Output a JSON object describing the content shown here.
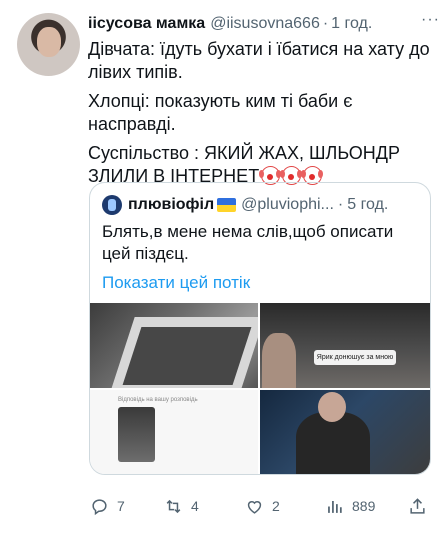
{
  "tweet": {
    "author_name": "іісусова мамка",
    "author_handle": "@iisusovna666",
    "separator": "·",
    "time": "1 год.",
    "more_label": "···",
    "lines": [
      "Дівчата: їдуть бухати і їбатися на хату до лівих типів.",
      "Хлопці: показують ким ті баби є насправді.",
      "Суспільство : ЯКИЙ ЖАХ, ШЛЬОНДР ЗЛИЛИ В ІНТЕРНЕТ"
    ],
    "emoji_count": 3,
    "emoji_name": "clown-face"
  },
  "quote": {
    "author_name": "плювіофіл",
    "author_handle": "@pluviophi...",
    "separator": "·",
    "time": "5 год.",
    "text": "Блять,в мене нема слів,щоб описати цей піздєц.",
    "show_thread": "Показати цей потік",
    "media": {
      "caption_2": "Ярик донюшує за мною",
      "caption_3": "Відповідь на вашу розповідь"
    }
  },
  "actions": {
    "replies": "7",
    "retweets": "4",
    "likes": "2",
    "views": "889"
  },
  "colors": {
    "link": "#1d9bf0",
    "secondary_text": "#536471",
    "border": "#cfd9de"
  }
}
